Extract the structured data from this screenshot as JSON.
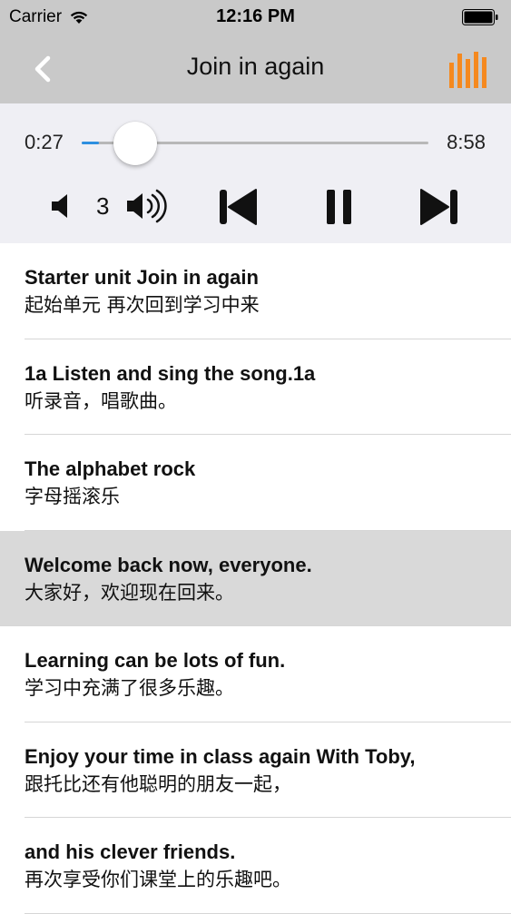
{
  "status_bar": {
    "carrier": "Carrier",
    "time": "12:16 PM",
    "icons": [
      "wifi-icon",
      "battery-icon"
    ]
  },
  "nav": {
    "title": "Join in again",
    "back_icon": "chevron-left-icon",
    "right_icon": "equalizer-icon",
    "accent_color": "#f5891f"
  },
  "player": {
    "current_time": "0:27",
    "total_time": "8:58",
    "progress": 0.05,
    "progress_color": "#2d8fe0",
    "volume_level": "3",
    "icons": [
      "volume-down-icon",
      "volume-up-icon",
      "skip-previous-icon",
      "pause-icon",
      "skip-next-icon"
    ]
  },
  "lyrics": [
    {
      "en": "Starter unit Join in again",
      "zh": "起始单元 再次回到学习中来",
      "active": false
    },
    {
      "en": "1a Listen and sing the song.1a",
      "zh": "听录音，唱歌曲。",
      "active": false
    },
    {
      "en": "The alphabet rock",
      "zh": "字母摇滚乐",
      "active": false
    },
    {
      "en": "Welcome back now, everyone.",
      "zh": "大家好，欢迎现在回来。",
      "active": true
    },
    {
      "en": "Learning can be lots of fun.",
      "zh": "学习中充满了很多乐趣。",
      "active": false
    },
    {
      "en": "Enjoy your time in class again With Toby,",
      "zh": "跟托比还有他聪明的朋友一起，",
      "active": false
    },
    {
      "en": "and his clever friends.",
      "zh": "再次享受你们课堂上的乐趣吧。",
      "active": false
    }
  ]
}
